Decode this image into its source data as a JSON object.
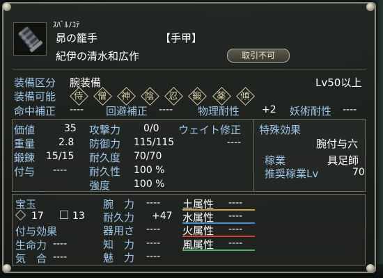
{
  "item": {
    "furigana": "ｽﾊﾞﾙﾉｺﾃ",
    "name": "昴の籠手",
    "slot": "【手甲】",
    "maker": "紀伊の清水和広作",
    "trade_badge": "取引不可"
  },
  "equip": {
    "class_label": "装備区分",
    "class_value": "腕装備",
    "level_req": "Lv50以上",
    "usable_label": "装備可能",
    "jobs": [
      "侍",
      "僧",
      "神",
      "陰",
      "忍",
      "鍛",
      "薬",
      "傾"
    ]
  },
  "bonus_row": {
    "hit_label": "命中補正",
    "hit_value": "----",
    "evade_label": "回避補正",
    "evade_value": "----",
    "phys_label": "物理耐性",
    "phys_value": "+2",
    "magic_label": "妖術耐性",
    "magic_value": "----"
  },
  "stats_left": [
    {
      "label": "価値",
      "value": "35"
    },
    {
      "label": "重量",
      "value": "2.8"
    },
    {
      "label": "鍛錬",
      "value": "15/15"
    },
    {
      "label": "付与",
      "value": "----"
    }
  ],
  "stats_mid": [
    {
      "label": "攻撃力",
      "value": "0/0"
    },
    {
      "label": "防御力",
      "value": "115/115"
    },
    {
      "label": "耐久度",
      "value": "70/70"
    },
    {
      "label": "耐久性",
      "value": "100 %"
    },
    {
      "label": "強度",
      "value": "100 %"
    }
  ],
  "weight_mod": {
    "label": "ウェイト修正",
    "value": "----"
  },
  "special": {
    "title": "特殊効果",
    "effect": "腕付与六",
    "trade_label": "稼業",
    "trade_value": "具足師",
    "rec_label": "推奨稼業Lv",
    "rec_value": "70"
  },
  "gems": {
    "title": "宝玉",
    "slot_a": "17",
    "slot_b": "13"
  },
  "enchant": {
    "title": "付与効果",
    "rows": [
      {
        "label": "生命力",
        "value": "----"
      },
      {
        "label": "気　合",
        "value": "----"
      }
    ]
  },
  "attr_mid": [
    {
      "label": "腕　力",
      "value": "----"
    },
    {
      "label": "耐久力",
      "value": "+47"
    },
    {
      "label": "器用さ",
      "value": "----"
    },
    {
      "label": "知　力",
      "value": "----"
    },
    {
      "label": "魅　力",
      "value": "----"
    }
  ],
  "elements": [
    {
      "label": "土属性",
      "value": "----",
      "color": "#c8a050"
    },
    {
      "label": "水属性",
      "value": "----",
      "color": "#4a90d0"
    },
    {
      "label": "火属性",
      "value": "----",
      "color": "#d04030"
    },
    {
      "label": "風属性",
      "value": "----",
      "color": "#50b070"
    }
  ]
}
